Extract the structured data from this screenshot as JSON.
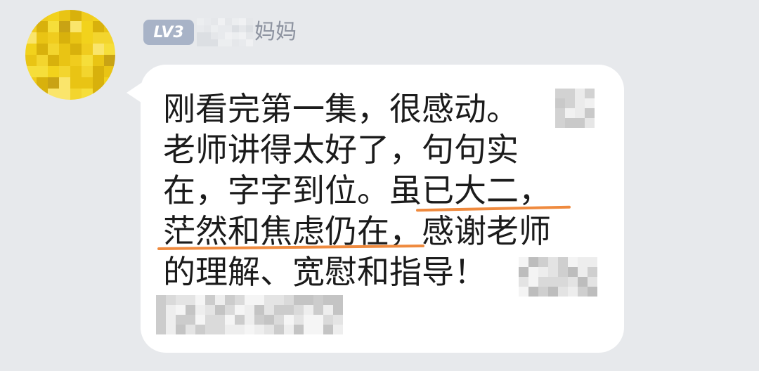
{
  "sender": {
    "level_badge": "LV3",
    "nickname_suffix": "妈妈"
  },
  "message": {
    "line1": "刚看完第一集，很感动。",
    "line2": "老师讲得太好了，句句实",
    "line3_prefix": "在，字字到位。",
    "line3_highlight": "虽已大二，",
    "line4_highlight": "茫然和焦虑仍在",
    "line4_suffix": "，感谢老师",
    "line5": "的理解、宽慰和指导！"
  },
  "colors": {
    "background": "#e7e9ec",
    "bubble": "#ffffff",
    "level_badge": "#a8b3c7",
    "underline": "#ef8a3e",
    "nickname": "#8d93a0"
  }
}
